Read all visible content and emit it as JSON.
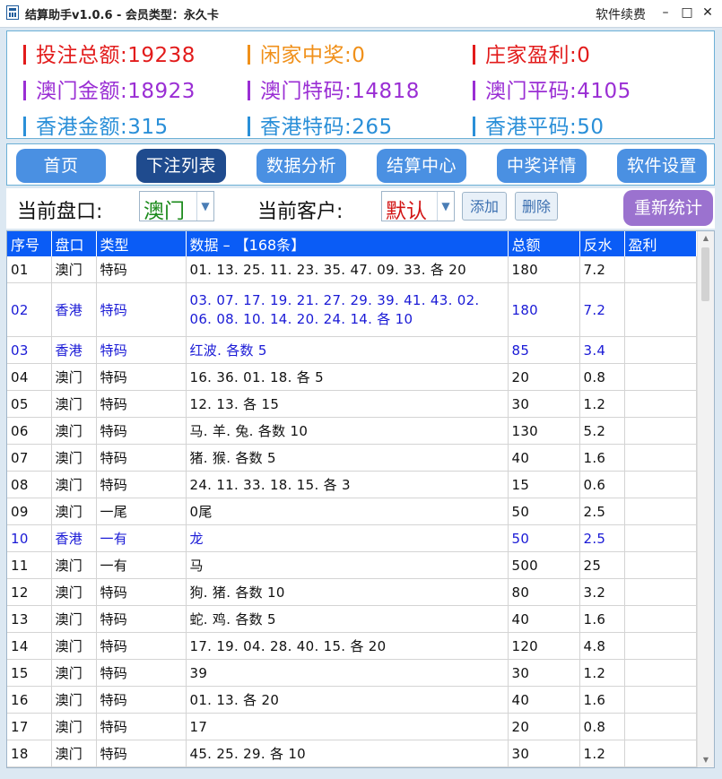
{
  "window": {
    "title": "结算助手v1.0.6 - 会员类型：永久卡",
    "renew": "软件续费",
    "min": "–",
    "max": "□",
    "close": "✕"
  },
  "stats": {
    "bet_total": "投注总额:19238",
    "player_win": "闲家中奖:0",
    "banker_profit": "庄家盈利:0",
    "macau_amount": "澳门金额:18923",
    "macau_special": "澳门特码:14818",
    "macau_flat": "澳门平码:4105",
    "hk_amount": "香港金额:315",
    "hk_special": "香港特码:265",
    "hk_flat": "香港平码:50"
  },
  "colors": {
    "red": "#e21b1b",
    "orange": "#f0901a",
    "purple": "#9a2ed4",
    "blue": "#2a8fd8",
    "nav": "#4a90e2",
    "nav_active": "#1f4b8e",
    "header": "#0a5cf6"
  },
  "nav": [
    "首页",
    "下注列表",
    "数据分析",
    "结算中心",
    "中奖详情",
    "软件设置"
  ],
  "filter": {
    "market_label": "当前盘口:",
    "market_value": "澳门",
    "customer_label": "当前客户:",
    "customer_value": "默认",
    "add": "添加",
    "delete": "删除",
    "recount": "重新统计"
  },
  "table": {
    "headers": [
      "序号",
      "盘口",
      "类型",
      "数据 – 【168条】",
      "总额",
      "反水",
      "盈利"
    ],
    "rows": [
      {
        "no": "01",
        "market": "澳门",
        "type": "特码",
        "data": "01. 13. 25. 11. 23. 35. 47. 09. 33. 各 20",
        "total": "180",
        "rebate": "7.2",
        "profit": "",
        "hl": false
      },
      {
        "no": "02",
        "market": "香港",
        "type": "特码",
        "data": "03. 07. 17. 19. 21. 27. 29. 39. 41. 43. 02. 06. 08. 10. 14. 20. 24. 14. 各 10",
        "total": "180",
        "rebate": "7.2",
        "profit": "",
        "hl": true,
        "wrap": true
      },
      {
        "no": "03",
        "market": "香港",
        "type": "特码",
        "data": "红波. 各数 5",
        "total": "85",
        "rebate": "3.4",
        "profit": "",
        "hl": true
      },
      {
        "no": "04",
        "market": "澳门",
        "type": "特码",
        "data": "16. 36. 01. 18. 各 5",
        "total": "20",
        "rebate": "0.8",
        "profit": "",
        "hl": false
      },
      {
        "no": "05",
        "market": "澳门",
        "type": "特码",
        "data": "12. 13. 各 15",
        "total": "30",
        "rebate": "1.2",
        "profit": "",
        "hl": false
      },
      {
        "no": "06",
        "market": "澳门",
        "type": "特码",
        "data": "马. 羊. 兔. 各数 10",
        "total": "130",
        "rebate": "5.2",
        "profit": "",
        "hl": false
      },
      {
        "no": "07",
        "market": "澳门",
        "type": "特码",
        "data": "猪. 猴. 各数 5",
        "total": "40",
        "rebate": "1.6",
        "profit": "",
        "hl": false
      },
      {
        "no": "08",
        "market": "澳门",
        "type": "特码",
        "data": "24. 11. 33. 18. 15. 各 3",
        "total": "15",
        "rebate": "0.6",
        "profit": "",
        "hl": false
      },
      {
        "no": "09",
        "market": "澳门",
        "type": "一尾",
        "data": "0尾",
        "total": "50",
        "rebate": "2.5",
        "profit": "",
        "hl": false
      },
      {
        "no": "10",
        "market": "香港",
        "type": "一有",
        "data": "龙",
        "total": "50",
        "rebate": "2.5",
        "profit": "",
        "hl": true
      },
      {
        "no": "11",
        "market": "澳门",
        "type": "一有",
        "data": "马",
        "total": "500",
        "rebate": "25",
        "profit": "",
        "hl": false
      },
      {
        "no": "12",
        "market": "澳门",
        "type": "特码",
        "data": "狗. 猪. 各数 10",
        "total": "80",
        "rebate": "3.2",
        "profit": "",
        "hl": false
      },
      {
        "no": "13",
        "market": "澳门",
        "type": "特码",
        "data": "蛇. 鸡. 各数 5",
        "total": "40",
        "rebate": "1.6",
        "profit": "",
        "hl": false
      },
      {
        "no": "14",
        "market": "澳门",
        "type": "特码",
        "data": "17. 19. 04. 28. 40. 15. 各 20",
        "total": "120",
        "rebate": "4.8",
        "profit": "",
        "hl": false
      },
      {
        "no": "15",
        "market": "澳门",
        "type": "特码",
        "data": "39",
        "total": "30",
        "rebate": "1.2",
        "profit": "",
        "hl": false
      },
      {
        "no": "16",
        "market": "澳门",
        "type": "特码",
        "data": "01. 13. 各 20",
        "total": "40",
        "rebate": "1.6",
        "profit": "",
        "hl": false
      },
      {
        "no": "17",
        "market": "澳门",
        "type": "特码",
        "data": "17",
        "total": "20",
        "rebate": "0.8",
        "profit": "",
        "hl": false
      },
      {
        "no": "18",
        "market": "澳门",
        "type": "特码",
        "data": "45. 25. 29. 各 10",
        "total": "30",
        "rebate": "1.2",
        "profit": "",
        "hl": false
      }
    ]
  }
}
